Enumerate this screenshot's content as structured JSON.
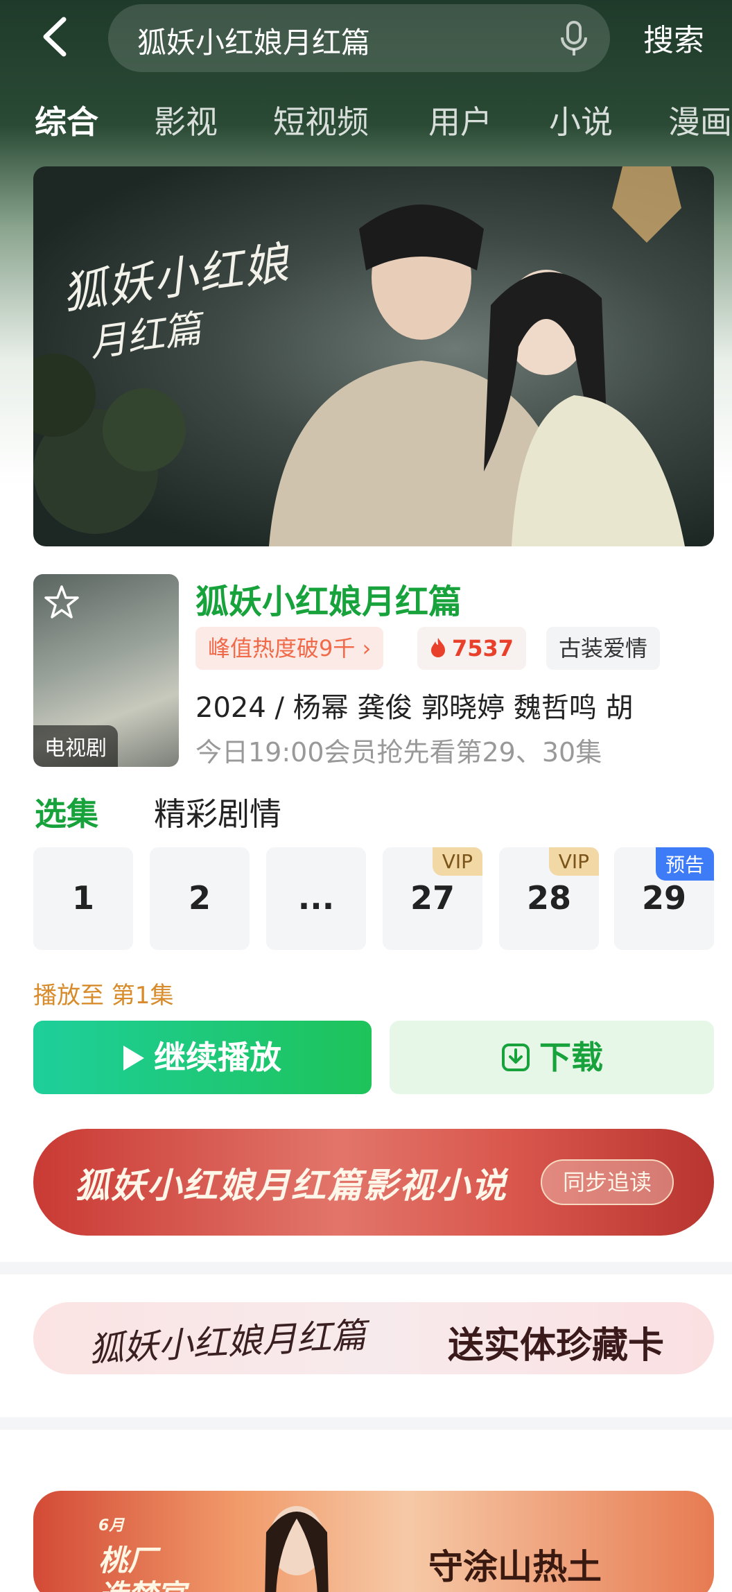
{
  "search": {
    "query": "狐妖小红娘月红篇",
    "button_label": "搜索"
  },
  "tabs": [
    {
      "label": "综合",
      "active": true
    },
    {
      "label": "影视",
      "active": false
    },
    {
      "label": "短视频",
      "active": false
    },
    {
      "label": "用户",
      "active": false
    },
    {
      "label": "小说",
      "active": false
    },
    {
      "label": "漫画",
      "active": false
    }
  ],
  "poster": {
    "title_line1": "狐妖小红娘",
    "title_line2": "月红篇"
  },
  "show": {
    "title": "狐妖小红娘月红篇",
    "thumb_badge": "电视剧",
    "heat_tag": "峰值热度破9千 ›",
    "heat_count": "7537",
    "genre": "古装爱情",
    "meta": "2024 / 杨幂  龚俊  郭晓婷  魏哲鸣  胡",
    "update": "今日19:00会员抢先看第29、30集"
  },
  "section_tabs": [
    {
      "label": "选集",
      "active": true
    },
    {
      "label": "精彩剧情",
      "active": false
    }
  ],
  "episodes": [
    {
      "num": "1",
      "badge": ""
    },
    {
      "num": "2",
      "badge": ""
    },
    {
      "num": "...",
      "badge": ""
    },
    {
      "num": "27",
      "badge": "VIP"
    },
    {
      "num": "28",
      "badge": "VIP"
    },
    {
      "num": "29",
      "badge": "预告"
    }
  ],
  "progress": "播放至 第1集",
  "actions": {
    "play": "继续播放",
    "download": "下载"
  },
  "banners": {
    "novel": {
      "text": "狐妖小红娘月红篇影视小说",
      "button": "同步追读"
    },
    "card": {
      "title": "狐妖小红娘月红篇",
      "promo": "送实体珍藏卡"
    },
    "dream": {
      "logo": "桃厂\n造梦官",
      "month": "6月",
      "text": "守涂山热土"
    }
  },
  "colors": {
    "accent": "#17a23c",
    "heat": "#f06a4a",
    "vip": "#f2d8a4",
    "preview": "#3e7cf7"
  }
}
